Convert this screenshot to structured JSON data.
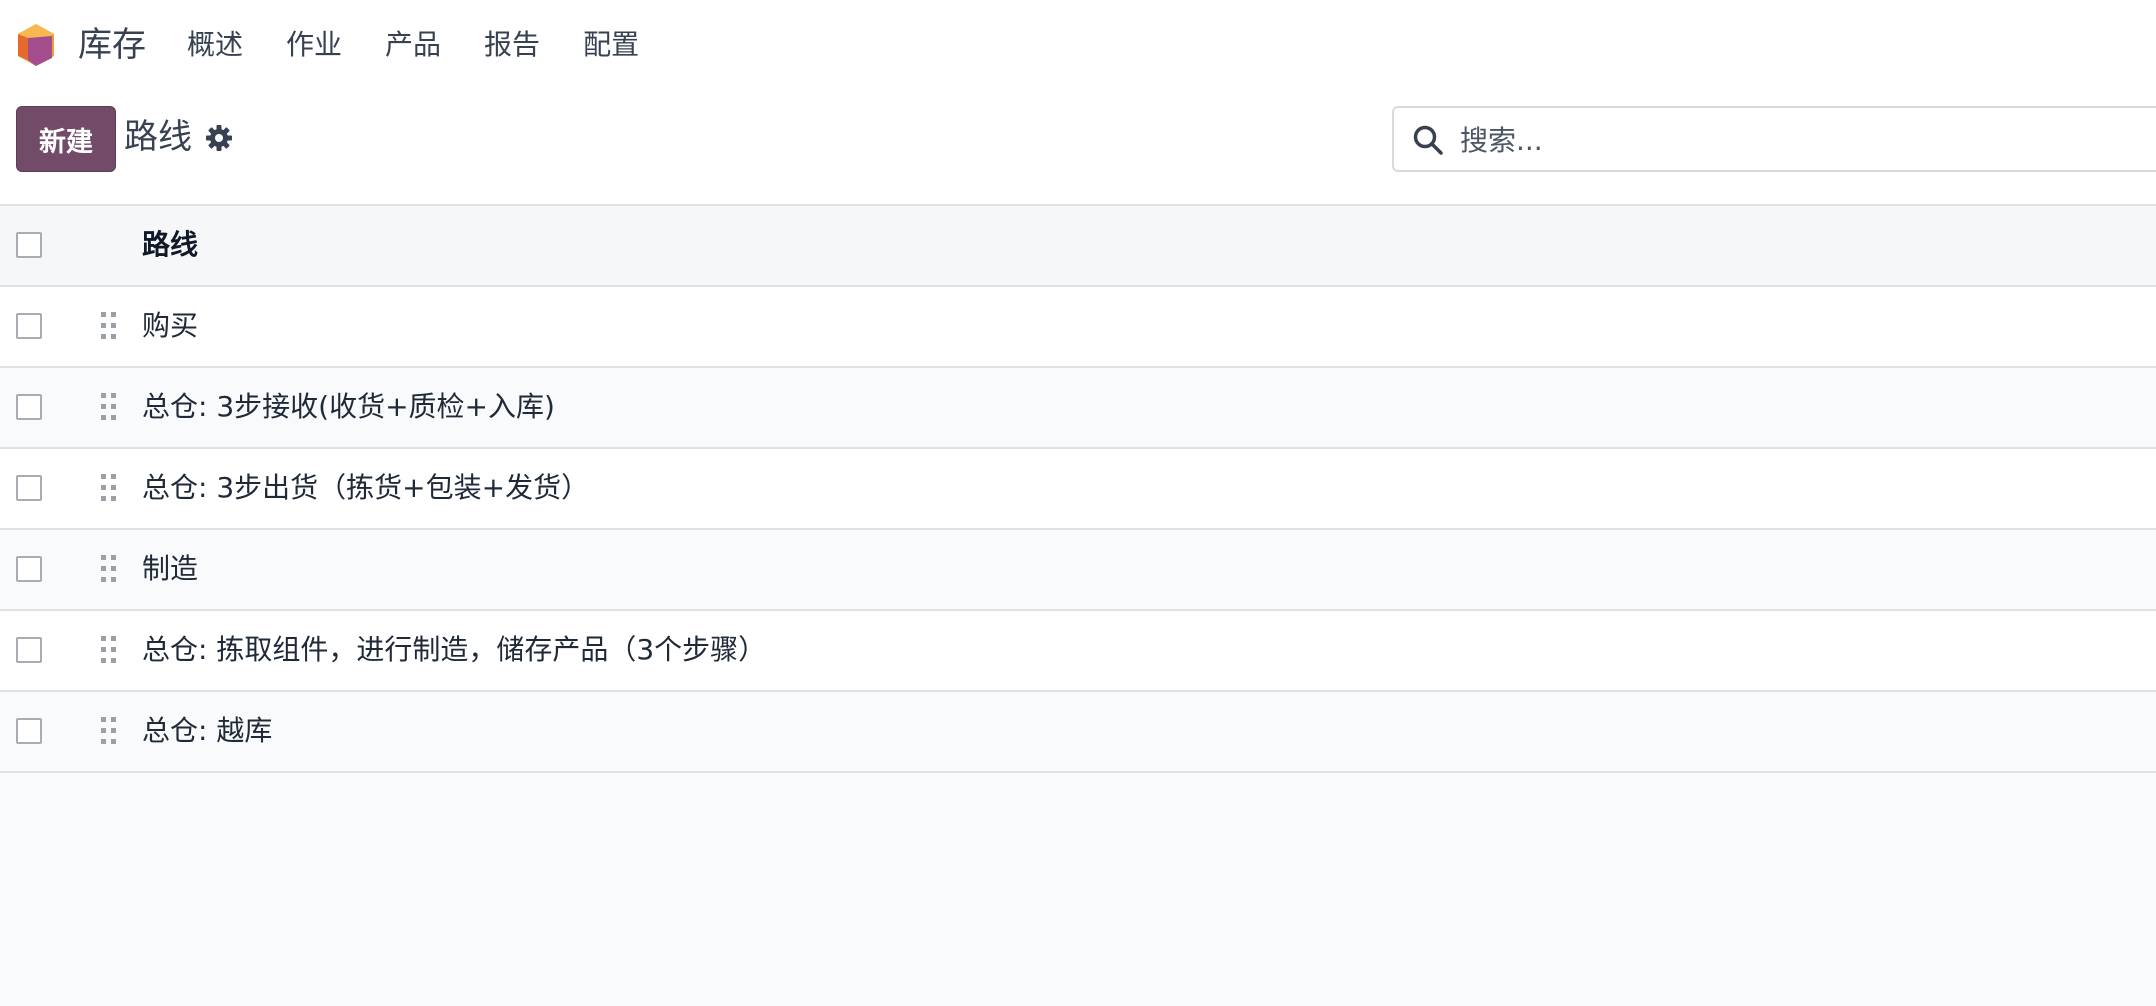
{
  "app": {
    "name": "库存"
  },
  "menu": [
    "概述",
    "作业",
    "产品",
    "报告",
    "配置"
  ],
  "controls": {
    "new_label": "新建",
    "page_title": "路线",
    "search_placeholder": "搜索..."
  },
  "table": {
    "header": "路线",
    "rows": [
      "购买",
      "总仓: 3步接收(收货+质检+入库)",
      "总仓: 3步出货（拣货+包装+发货）",
      "制造",
      "总仓: 拣取组件，进行制造，储存产品（3个步骤）",
      "总仓: 越库"
    ]
  },
  "colors": {
    "brand": "#714B67",
    "logo_orange": "#F5A623",
    "logo_purple": "#9B59B6"
  }
}
